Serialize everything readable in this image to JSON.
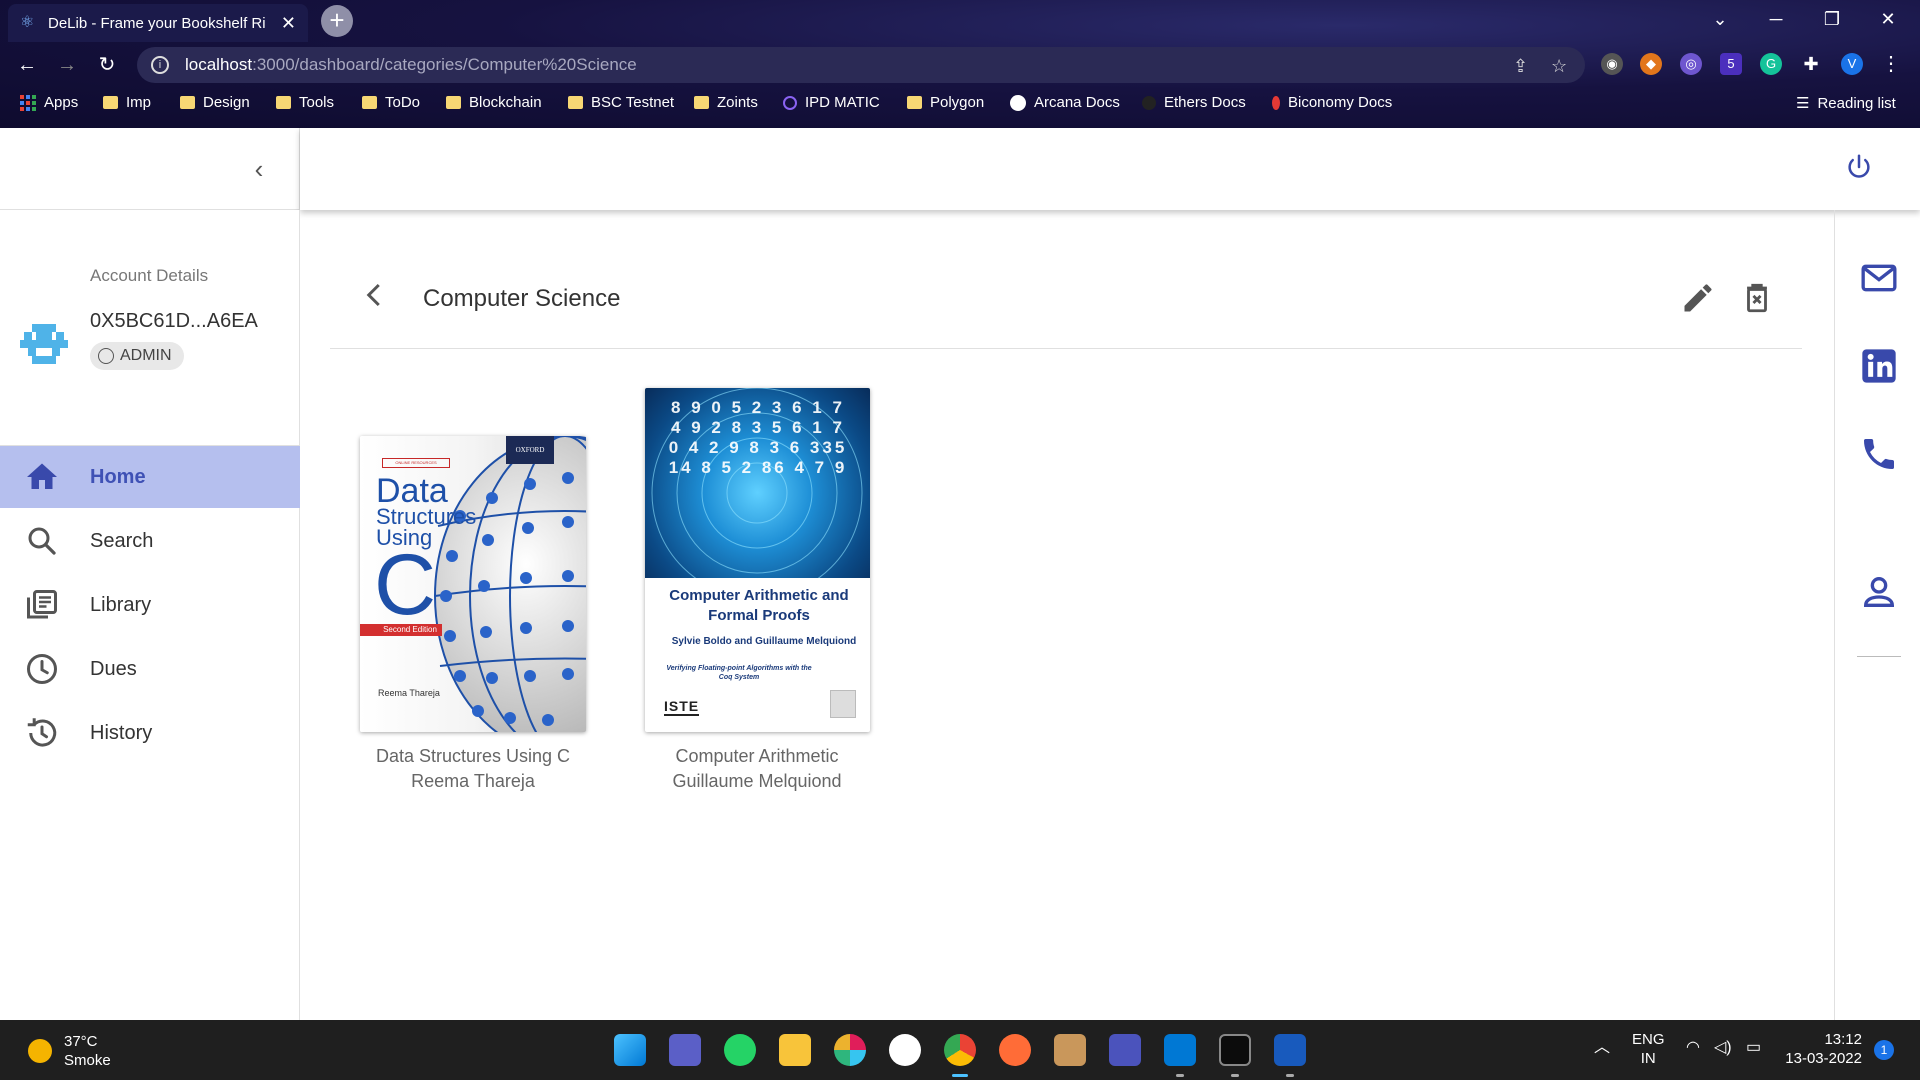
{
  "browser": {
    "tab_title": "DeLib - Frame your Bookshelf Ri",
    "url_host": "localhost",
    "url_path": ":3000/dashboard/categories/Computer%20Science",
    "profile_initial": "V",
    "ext_badge": "5",
    "bookmarks": [
      "Apps",
      "Imp",
      "Design",
      "Tools",
      "ToDo",
      "Blockchain",
      "BSC Testnet",
      "Zoints",
      "IPD MATIC",
      "Polygon",
      "Arcana Docs",
      "Ethers Docs",
      "Biconomy Docs"
    ],
    "reading_list": "Reading list"
  },
  "sidebar": {
    "account_heading": "Account Details",
    "account_address": "0X5BC61D...A6EA",
    "role": "ADMIN",
    "nav": [
      {
        "label": "Home",
        "icon": "home-icon",
        "active": true
      },
      {
        "label": "Search",
        "icon": "search-icon",
        "active": false
      },
      {
        "label": "Library",
        "icon": "library-icon",
        "active": false
      },
      {
        "label": "Dues",
        "icon": "clock-icon",
        "active": false
      },
      {
        "label": "History",
        "icon": "history-icon",
        "active": false
      }
    ]
  },
  "main": {
    "category_title": "Computer Science",
    "books": [
      {
        "title": "Data Structures Using C",
        "author": "Reema Thareja",
        "cover": {
          "publisher": "OXFORD",
          "badge": "ONLINE RESOURCES",
          "line1": "Data",
          "line2": "Structures",
          "line3": "Using",
          "big_letter": "C",
          "edition": "Second Edition",
          "author": "Reema Thareja"
        }
      },
      {
        "title": "Computer Arithmetic",
        "author": "Guillaume Melquiond",
        "cover": {
          "title": "Computer Arithmetic and Formal Proofs",
          "authors": "Sylvie Boldo and Guillaume Melquiond",
          "subtitle": "Verifying Floating-point Algorithms with the Coq System",
          "publisher": "ISTE",
          "digits": "8 9 0 5 2 3 6 1 7 4 9 2 8 3 5 6 1 7 0 4 2 9 8 3 6 335 14 8 5 2 86 4 7 9"
        }
      }
    ]
  },
  "taskbar": {
    "temperature": "37°C",
    "weather": "Smoke",
    "language": "ENG",
    "region": "IN",
    "time": "13:12",
    "date": "13-03-2022",
    "notifications": "1"
  },
  "colors": {
    "accent": "#3f51b5",
    "active_bg": "#b5bfee",
    "icon_blue": "#3949ab"
  }
}
